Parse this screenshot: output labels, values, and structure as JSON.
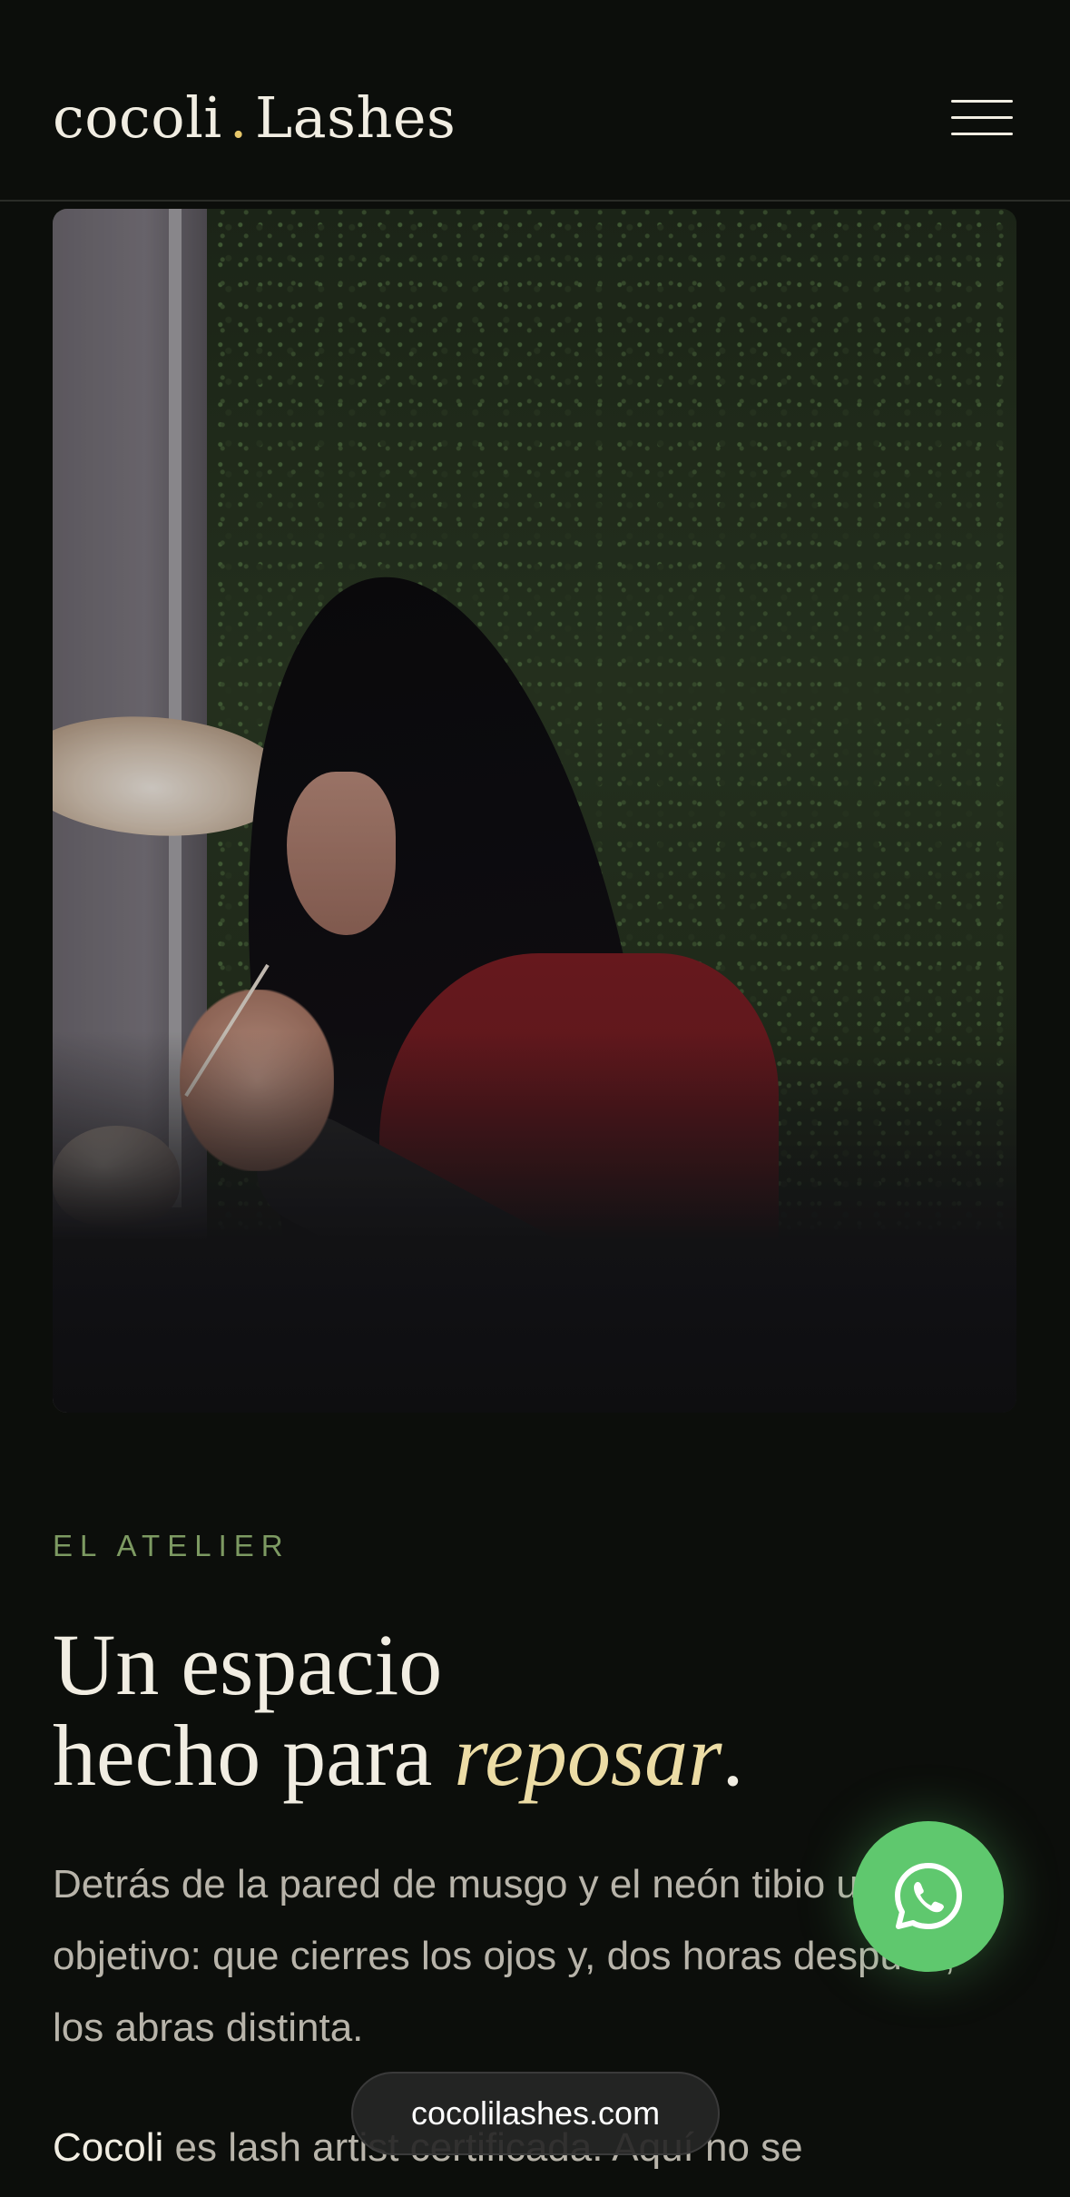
{
  "header": {
    "brand_left": "cocoli",
    "brand_dot": ".",
    "brand_right": "Lashes",
    "menu_icon": "hamburger-menu-icon"
  },
  "hero": {
    "image_subject": "lash artist working beside moss wall"
  },
  "atelier": {
    "eyebrow": "EL ATELIER",
    "heading_line1": "Un espacio",
    "heading_line2_prefix": "hecho para ",
    "heading_line2_accent": "reposar",
    "heading_line2_suffix": ".",
    "paragraph": "Detrás de la pared de musgo y el neón tibio un solo objetivo: que cierres los ojos y, dos horas después, los abras distinta.",
    "paragraph2_bold": "Cocoli",
    "paragraph2_rest": " es lash artist certificada. Aquí no se"
  },
  "floating": {
    "whatsapp_icon": "whatsapp-icon",
    "url": "cocolilashes.com"
  },
  "colors": {
    "background": "#0c0e0b",
    "accent_gold": "#e6c76a",
    "eyebrow_green": "#7d9a62",
    "accent_italic": "#ecdca5",
    "whatsapp_green": "#5fc86e"
  }
}
